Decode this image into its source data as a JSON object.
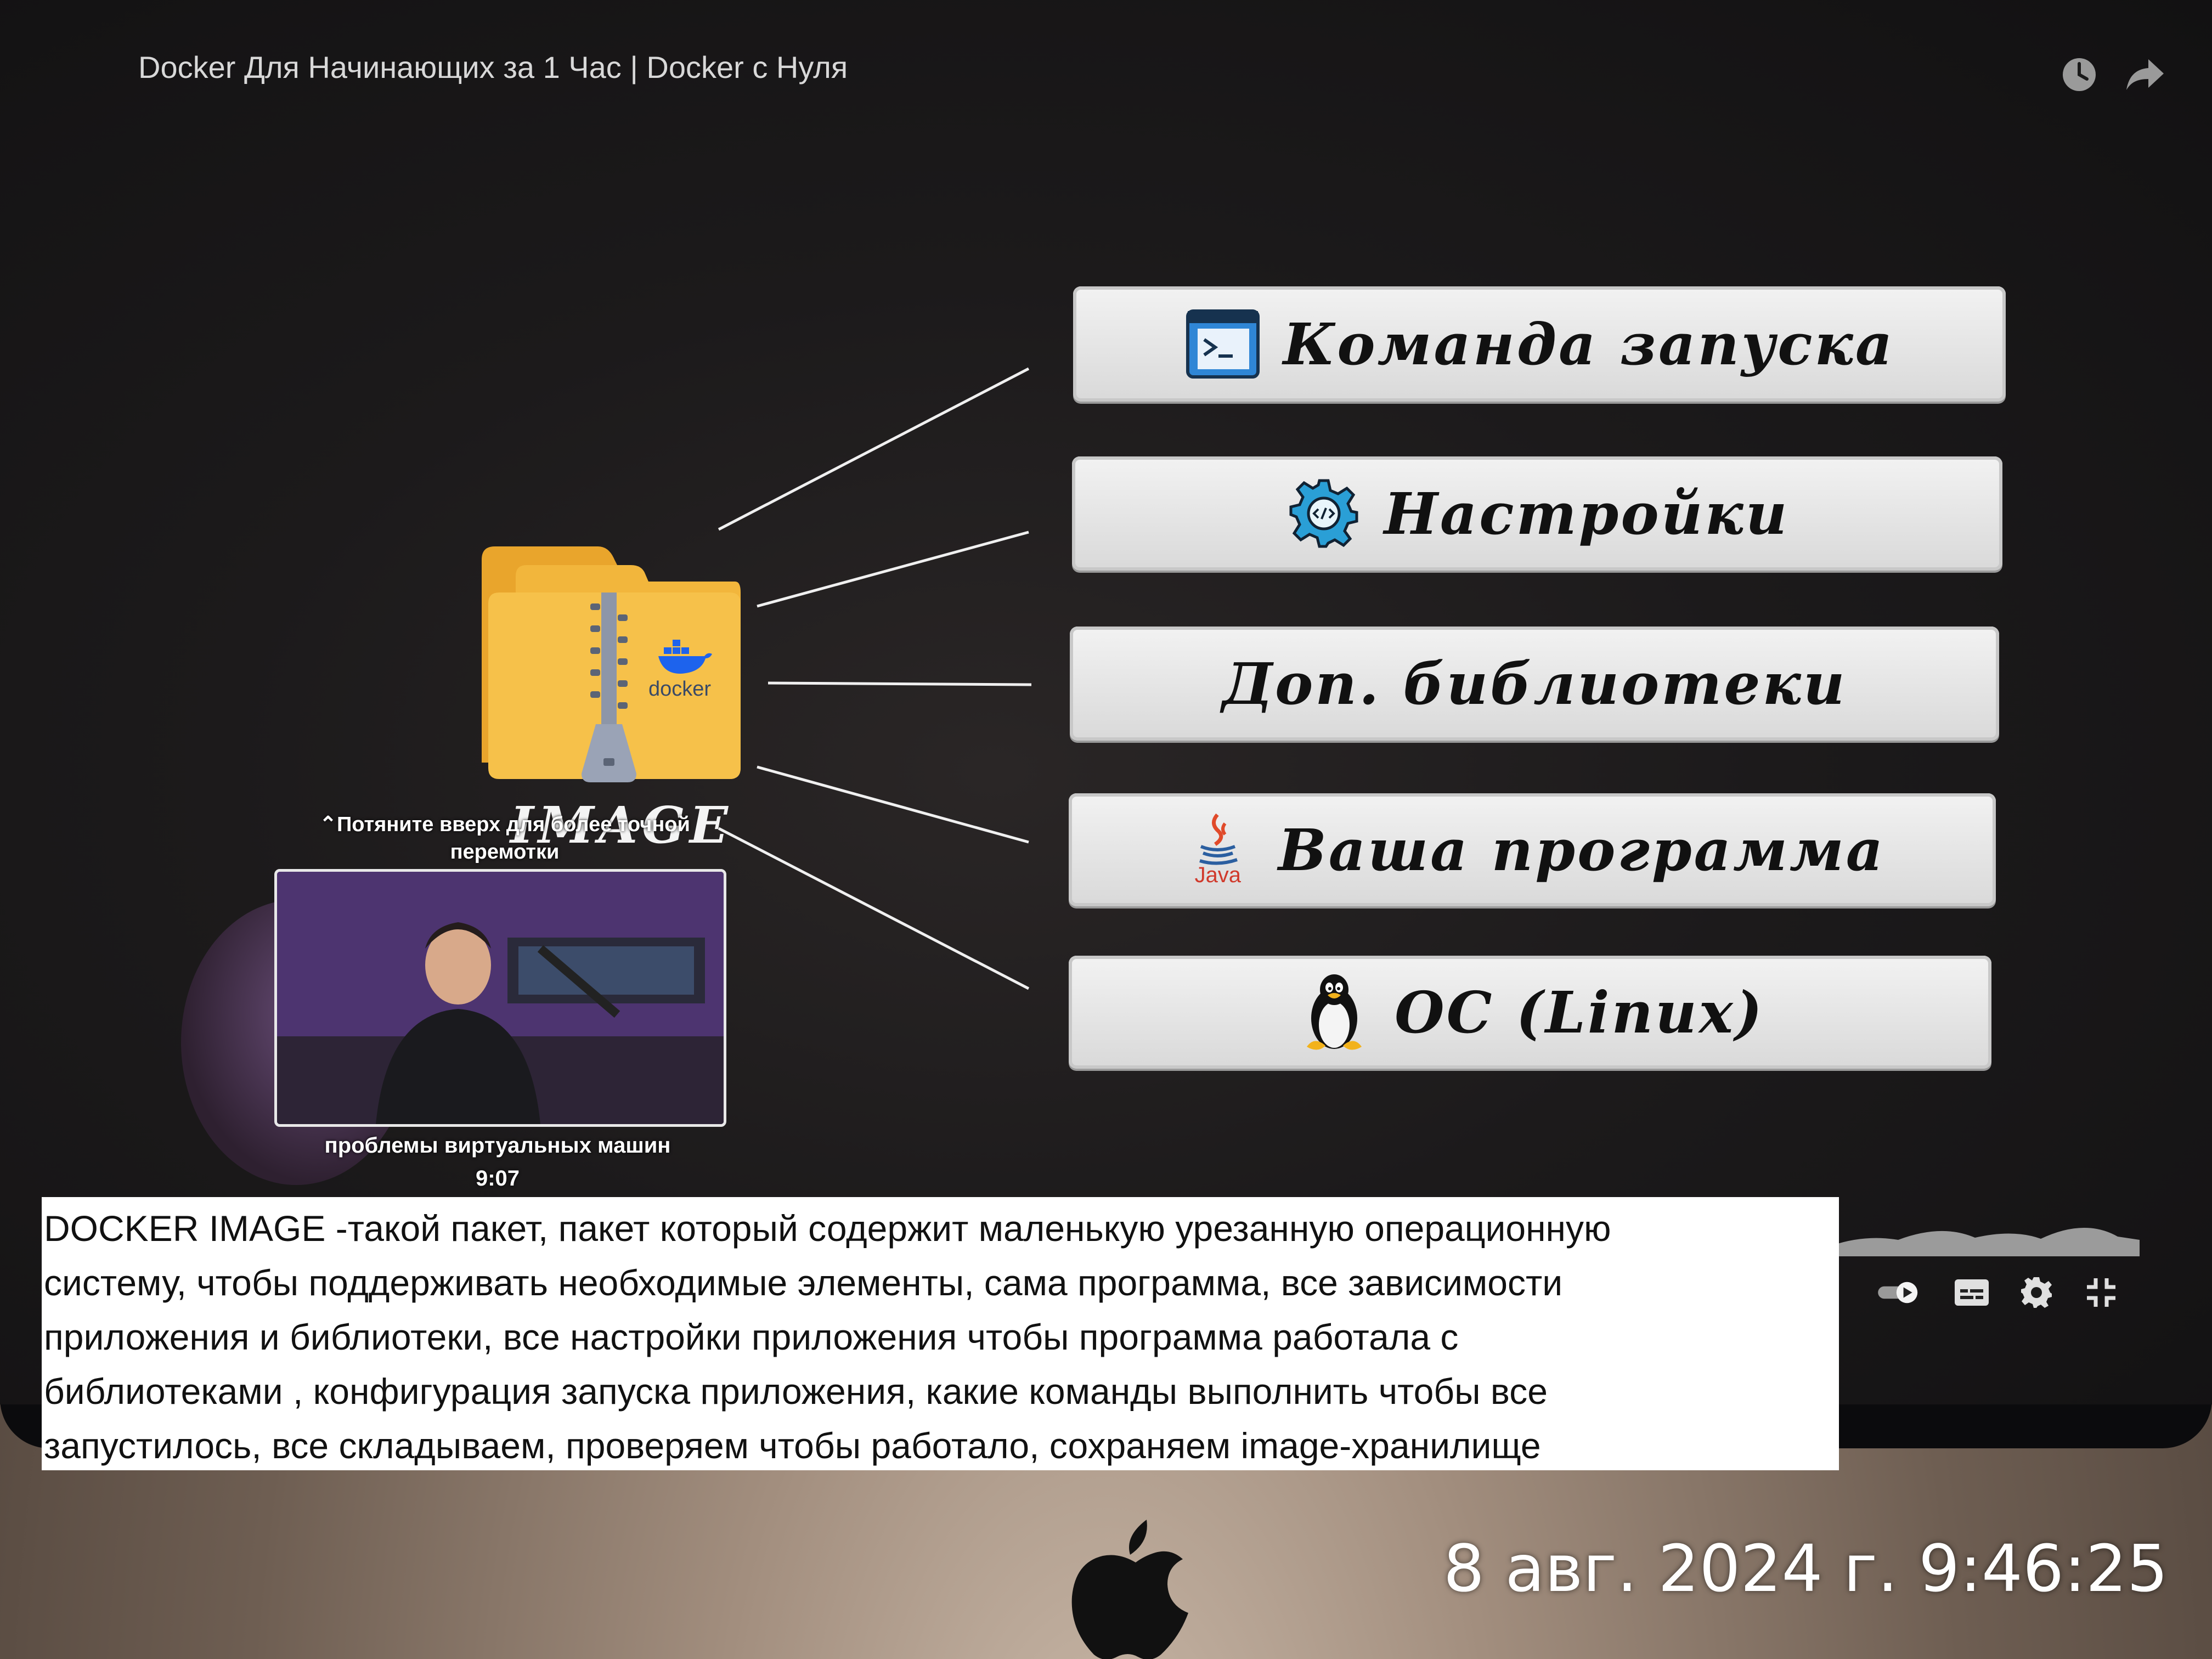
{
  "player": {
    "title": "Docker Для Начинающих за 1 Час | Docker с Нуля",
    "top_icons": [
      "clock-icon",
      "share-icon"
    ]
  },
  "slide": {
    "folder_label": "IMAGE",
    "folder_logo_text": "docker",
    "cards": [
      {
        "label": "Команда запуска",
        "icon": "terminal-icon"
      },
      {
        "label": "Настройки",
        "icon": "gear-icon"
      },
      {
        "label": "Доп. библиотеки",
        "icon": ""
      },
      {
        "label": "Ваша программа",
        "icon": "java-icon",
        "icon_text": "Java"
      },
      {
        "label": "ОС (Linux)",
        "icon": "linux-penguin-icon"
      }
    ]
  },
  "seek": {
    "hint_line1": "⌃Потяните вверх для более точной",
    "hint_line2": "перемотки",
    "preview_title": "проблемы виртуальных машин",
    "preview_time": "9:07"
  },
  "controls": [
    "autoplay-toggle-icon",
    "subtitles-icon",
    "settings-gear-icon",
    "exit-fullscreen-icon"
  ],
  "note": {
    "text": "DOCKER IMAGE -такой пакет, пакет который содержит маленькую урезанную операционную\nсистему, чтобы поддерживать необходимые элементы, сама программа, все зависимости\nприложения и библиотеки, все настройки приложения чтобы программа работала с\nбиблиотеками , конфигурация запуска приложения, какие команды выполнить чтобы все\nзапустилось, все складываем, проверяем чтобы работало, сохраняем image-хранилище"
  },
  "photo": {
    "timestamp": "8 авг. 2024 г. 9:46:25"
  },
  "colors": {
    "card_bg": "#e6e6e6",
    "folder": "#f4b73a",
    "docker_blue": "#1d63ed",
    "screen_bg": "#1c1a1b"
  }
}
